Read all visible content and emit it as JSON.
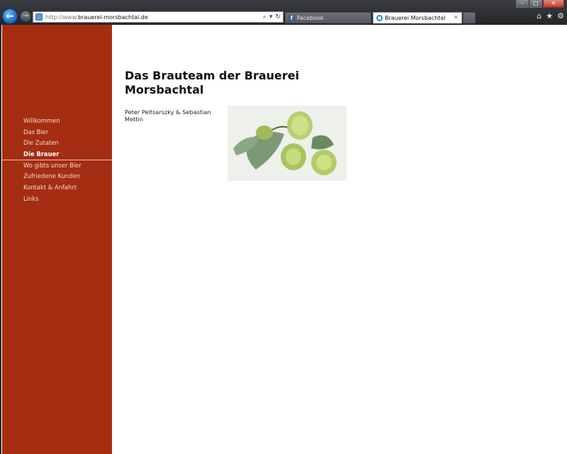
{
  "browser": {
    "url_prefix": "http://www.",
    "url_domain": "brauerei-morsbachtal.de",
    "tabs": [
      {
        "label": "Facebook",
        "active": false,
        "icon": "facebook-icon"
      },
      {
        "label": "Brauerei Morsbachtal",
        "active": true,
        "icon": "ie-page-icon"
      }
    ],
    "close_tab_glyph": "×",
    "toolbar_icons": [
      "home-icon",
      "favorites-star-icon",
      "tools-gear-icon"
    ],
    "colors": {
      "chrome": "#2e3035",
      "accent_back": "#1e7bd6"
    }
  },
  "sidebar": {
    "color": "#a52d12",
    "items": [
      {
        "label": "Willkommen",
        "active": false
      },
      {
        "label": "Das Bier",
        "active": false
      },
      {
        "label": "Die Zutaten",
        "active": false
      },
      {
        "label": "Die Brauer",
        "active": true
      },
      {
        "label": "Wo gibts unser Bier",
        "active": false
      },
      {
        "label": "Zufriedene Kunden",
        "active": false
      },
      {
        "label": "Kontakt & Anfahrt",
        "active": false
      },
      {
        "label": "Links",
        "active": false
      }
    ]
  },
  "main": {
    "title": "Das Brauteam der Brauerei Morsbachtal",
    "caption": "Peter Peltsarszky & Sebastian Mettin",
    "image_subject": "hops-photo"
  }
}
